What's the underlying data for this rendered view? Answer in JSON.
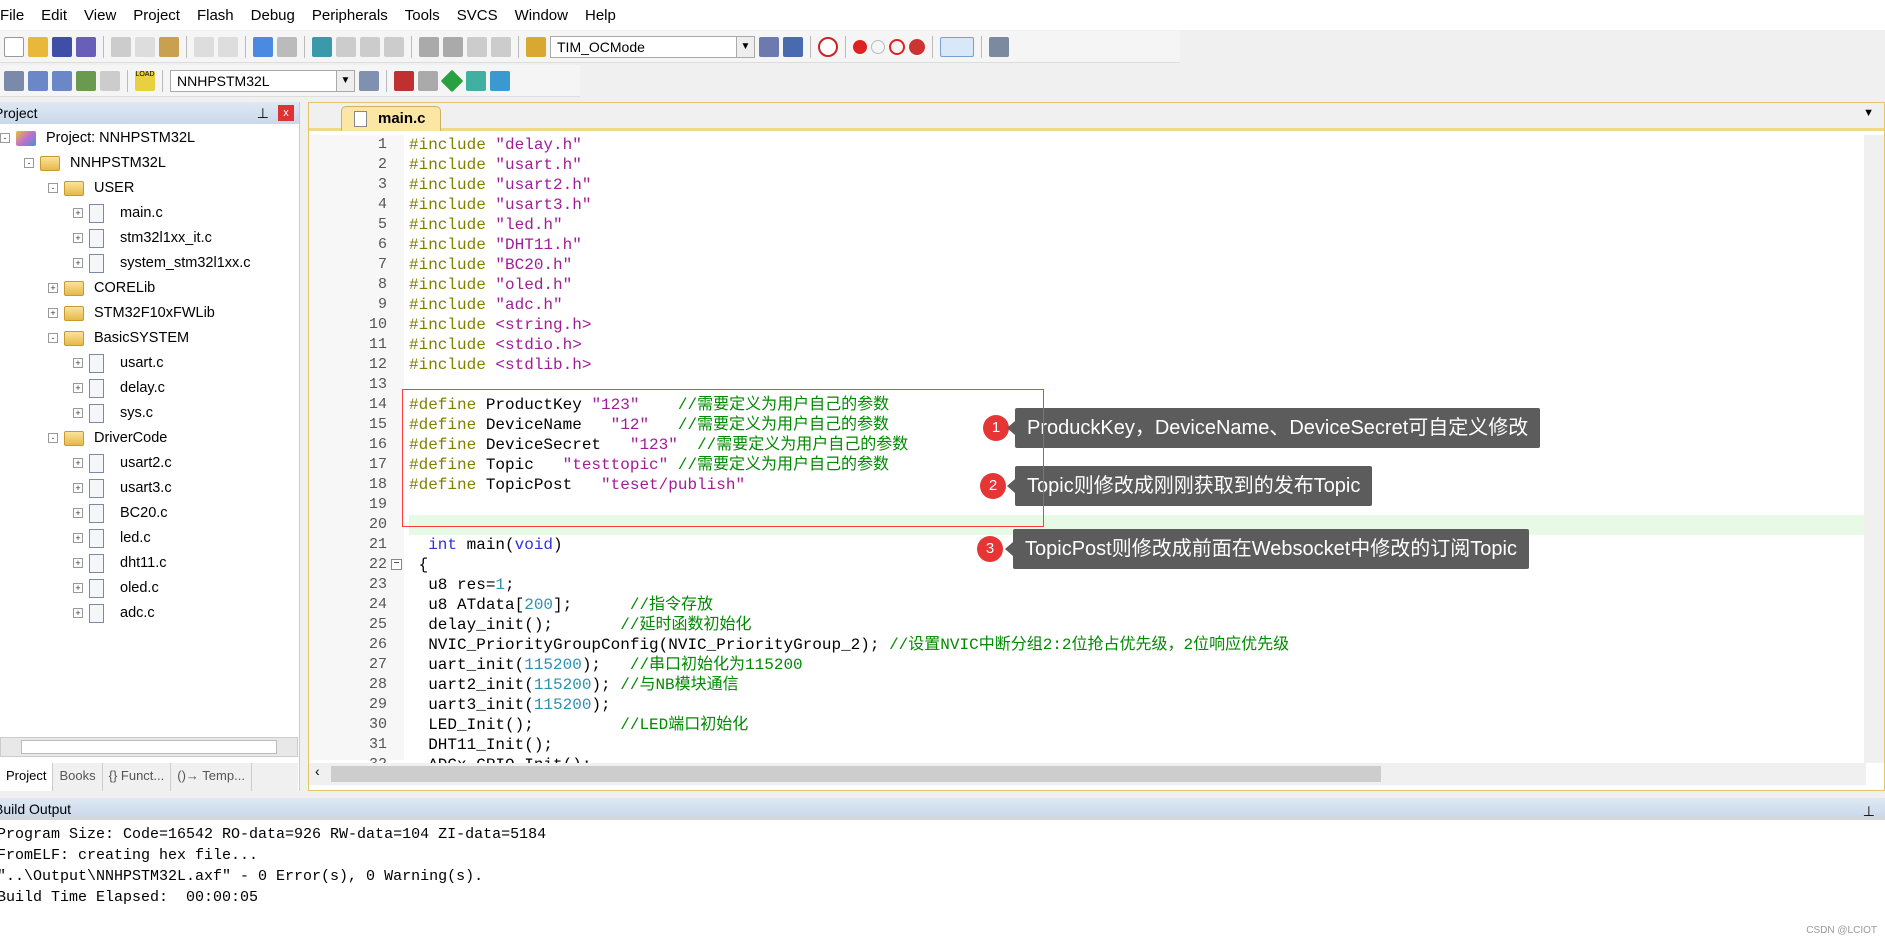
{
  "menu": [
    "File",
    "Edit",
    "View",
    "Project",
    "Flash",
    "Debug",
    "Peripherals",
    "Tools",
    "SVCS",
    "Window",
    "Help"
  ],
  "toolbar": {
    "find_combo": "TIM_OCMode",
    "target_combo": "NNHPSTM32L",
    "load_label": "LOAD"
  },
  "project_panel": {
    "title": "Project",
    "tree": [
      {
        "level": 0,
        "label": "Project: NNHPSTM32L",
        "type": "project",
        "exp": "-"
      },
      {
        "level": 1,
        "label": "NNHPSTM32L",
        "type": "target",
        "exp": "-"
      },
      {
        "level": 2,
        "label": "USER",
        "type": "folder",
        "exp": "-"
      },
      {
        "level": 3,
        "label": "main.c",
        "type": "file",
        "exp": "+"
      },
      {
        "level": 3,
        "label": "stm32l1xx_it.c",
        "type": "file",
        "exp": "+"
      },
      {
        "level": 3,
        "label": "system_stm32l1xx.c",
        "type": "file",
        "exp": "+"
      },
      {
        "level": 2,
        "label": "CORELib",
        "type": "folder",
        "exp": "+"
      },
      {
        "level": 2,
        "label": "STM32F10xFWLib",
        "type": "folder",
        "exp": "+"
      },
      {
        "level": 2,
        "label": "BasicSYSTEM",
        "type": "folder",
        "exp": "-"
      },
      {
        "level": 3,
        "label": "usart.c",
        "type": "file",
        "exp": "+"
      },
      {
        "level": 3,
        "label": "delay.c",
        "type": "file",
        "exp": "+"
      },
      {
        "level": 3,
        "label": "sys.c",
        "type": "file",
        "exp": "+"
      },
      {
        "level": 2,
        "label": "DriverCode",
        "type": "folder",
        "exp": "-"
      },
      {
        "level": 3,
        "label": "usart2.c",
        "type": "file",
        "exp": "+"
      },
      {
        "level": 3,
        "label": "usart3.c",
        "type": "file",
        "exp": "+"
      },
      {
        "level": 3,
        "label": "BC20.c",
        "type": "file",
        "exp": "+"
      },
      {
        "level": 3,
        "label": "led.c",
        "type": "file",
        "exp": "+"
      },
      {
        "level": 3,
        "label": "dht11.c",
        "type": "file",
        "exp": "+"
      },
      {
        "level": 3,
        "label": "oled.c",
        "type": "file",
        "exp": "+"
      },
      {
        "level": 3,
        "label": "adc.c",
        "type": "file",
        "exp": "+"
      }
    ],
    "tabs": [
      "Project",
      "Books",
      "{} Funct...",
      "()→ Temp..."
    ]
  },
  "editor": {
    "tab": "main.c",
    "lines": [
      [
        [
          "#include ",
          "pp"
        ],
        [
          "\"delay.h\"",
          "str"
        ]
      ],
      [
        [
          "#include ",
          "pp"
        ],
        [
          "\"usart.h\"",
          "str"
        ]
      ],
      [
        [
          "#include ",
          "pp"
        ],
        [
          "\"usart2.h\"",
          "str"
        ]
      ],
      [
        [
          "#include ",
          "pp"
        ],
        [
          "\"usart3.h\"",
          "str"
        ]
      ],
      [
        [
          "#include ",
          "pp"
        ],
        [
          "\"led.h\"",
          "str"
        ]
      ],
      [
        [
          "#include ",
          "pp"
        ],
        [
          "\"DHT11.h\"",
          "str"
        ]
      ],
      [
        [
          "#include ",
          "pp"
        ],
        [
          "\"BC20.h\"",
          "str"
        ]
      ],
      [
        [
          "#include ",
          "pp"
        ],
        [
          "\"oled.h\"",
          "str"
        ]
      ],
      [
        [
          "#include ",
          "pp"
        ],
        [
          "\"adc.h\"",
          "str"
        ]
      ],
      [
        [
          "#include ",
          "pp"
        ],
        [
          "<string.h>",
          "str"
        ]
      ],
      [
        [
          "#include ",
          "pp"
        ],
        [
          "<stdio.h>",
          "str"
        ]
      ],
      [
        [
          "#include ",
          "pp"
        ],
        [
          "<stdlib.h>",
          "str"
        ]
      ],
      [],
      [
        [
          "#define ",
          "pp"
        ],
        [
          "ProductKey ",
          "pl"
        ],
        [
          "\"123\"",
          "str"
        ],
        [
          "    //需要定义为用户自己的参数",
          "com"
        ]
      ],
      [
        [
          "#define ",
          "pp"
        ],
        [
          "DeviceName   ",
          "pl"
        ],
        [
          "\"12\"",
          "str"
        ],
        [
          "   //需要定义为用户自己的参数",
          "com"
        ]
      ],
      [
        [
          "#define ",
          "pp"
        ],
        [
          "DeviceSecret   ",
          "pl"
        ],
        [
          "\"123\"",
          "str"
        ],
        [
          "  //需要定义为用户自己的参数",
          "com"
        ]
      ],
      [
        [
          "#define ",
          "pp"
        ],
        [
          "Topic   ",
          "pl"
        ],
        [
          "\"testtopic\"",
          "str"
        ],
        [
          " //需要定义为用户自己的参数",
          "com"
        ]
      ],
      [
        [
          "#define ",
          "pp"
        ],
        [
          "TopicPost   ",
          "pl"
        ],
        [
          "\"teset/publish\"",
          "str"
        ]
      ],
      [],
      [],
      [
        [
          "  ",
          "pl"
        ],
        [
          "int",
          "kw"
        ],
        [
          " main(",
          "pl"
        ],
        [
          "void",
          "kw"
        ],
        [
          ")",
          "pl"
        ]
      ],
      [
        [
          " {",
          "pl"
        ]
      ],
      [
        [
          "  u8 res=",
          "pl"
        ],
        [
          "1",
          "num"
        ],
        [
          ";",
          "pl"
        ]
      ],
      [
        [
          "  u8 ATdata[",
          "pl"
        ],
        [
          "200",
          "num"
        ],
        [
          "];      ",
          "pl"
        ],
        [
          "//指令存放",
          "com"
        ]
      ],
      [
        [
          "  delay_init();       ",
          "pl"
        ],
        [
          "//延时函数初始化",
          "com"
        ]
      ],
      [
        [
          "  NVIC_PriorityGroupConfig(NVIC_PriorityGroup_2); ",
          "pl"
        ],
        [
          "//设置NVIC中断分组2:2位抢占优先级，2位响应优先级",
          "com"
        ]
      ],
      [
        [
          "  uart_init(",
          "pl"
        ],
        [
          "115200",
          "num"
        ],
        [
          ");   ",
          "pl"
        ],
        [
          "//串口初始化为115200",
          "com"
        ]
      ],
      [
        [
          "  uart2_init(",
          "pl"
        ],
        [
          "115200",
          "num"
        ],
        [
          "); ",
          "pl"
        ],
        [
          "//与NB模块通信",
          "com"
        ]
      ],
      [
        [
          "  uart3_init(",
          "pl"
        ],
        [
          "115200",
          "num"
        ],
        [
          ");",
          "pl"
        ]
      ],
      [
        [
          "  LED_Init();         ",
          "pl"
        ],
        [
          "//LED端口初始化",
          "com"
        ]
      ],
      [
        [
          "  DHT11_Init();",
          "pl"
        ]
      ],
      [
        [
          "  ADCx_GPIO_Init();",
          "pl"
        ]
      ]
    ]
  },
  "annotations": [
    {
      "number": "1",
      "text": "ProduckKey，DeviceName、DeviceSecret可自定义修改"
    },
    {
      "number": "2",
      "text": "Topic则修改成刚刚获取到的发布Topic"
    },
    {
      "number": "3",
      "text": "TopicPost则修改成前面在Websocket中修改的订阅Topic"
    }
  ],
  "build_output": {
    "title": "Build Output",
    "lines": [
      "Program Size: Code=16542 RO-data=926 RW-data=104 ZI-data=5184",
      "FromELF: creating hex file...",
      "\"..\\Output\\NNHPSTM32L.axf\" - 0 Error(s), 0 Warning(s).",
      "Build Time Elapsed:  00:00:05"
    ]
  },
  "watermark": "CSDN @LCIOT",
  "colors": {
    "highlight_line": "#e6fae6",
    "annotation_box": "#ff3b3b",
    "badge": "#e53535",
    "callout_bg": "#5c5c5c"
  }
}
